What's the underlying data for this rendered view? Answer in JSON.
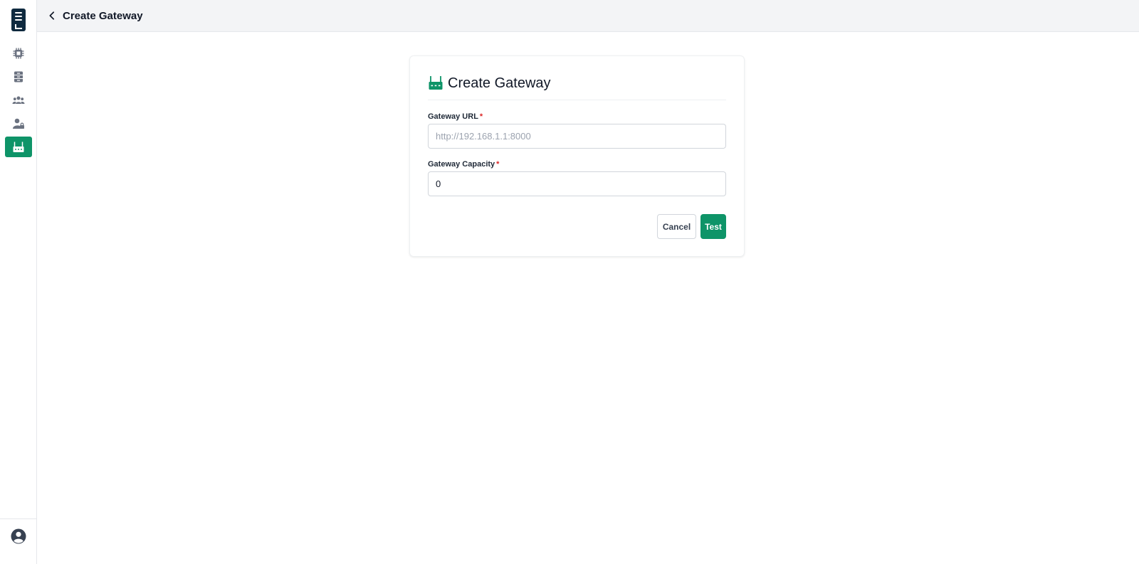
{
  "header": {
    "title": "Create Gateway"
  },
  "sidebar": {
    "items": [
      {
        "icon": "chip-icon",
        "active": false
      },
      {
        "icon": "server-icon",
        "active": false
      },
      {
        "icon": "users-icon",
        "active": false
      },
      {
        "icon": "user-lock-icon",
        "active": false
      },
      {
        "icon": "gateway-icon",
        "active": true
      }
    ],
    "bottom_icon": "account-icon"
  },
  "form": {
    "title": "Create Gateway",
    "url_label": "Gateway URL",
    "url_required": "*",
    "url_placeholder": "http://192.168.1.1:8000",
    "url_value": "",
    "capacity_label": "Gateway Capacity",
    "capacity_required": "*",
    "capacity_value": "0",
    "cancel_label": "Cancel",
    "test_label": "Test"
  },
  "colors": {
    "accent": "#0e9468",
    "logo": "#0f2a3f",
    "icon_gray": "#6b7280",
    "required": "#dc2626"
  }
}
